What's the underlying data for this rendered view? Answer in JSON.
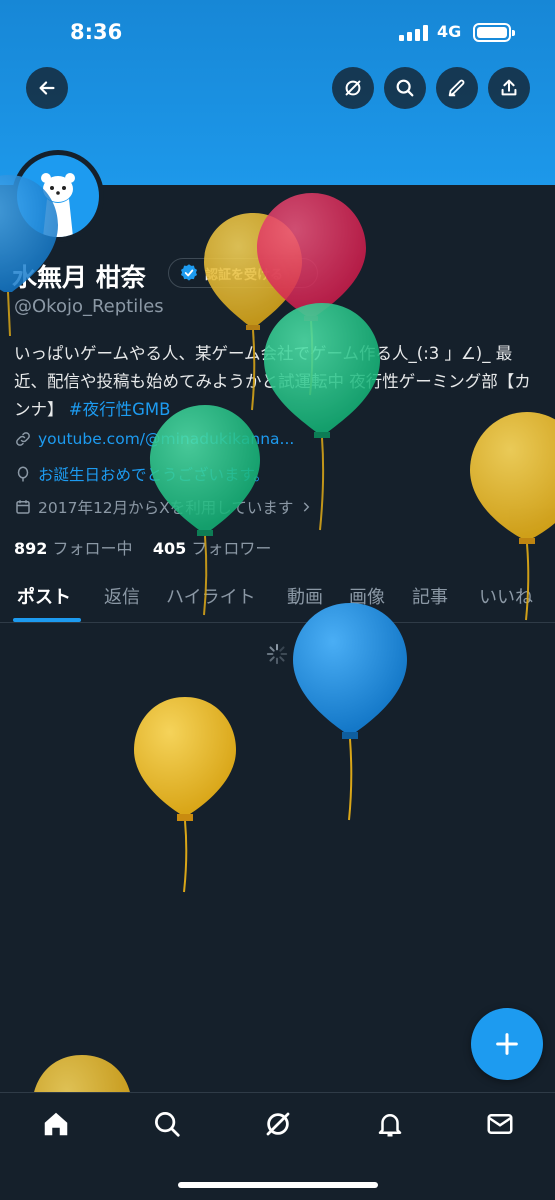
{
  "status_bar": {
    "time": "8:36",
    "network": "4G"
  },
  "header": {
    "back_icon": "arrow-left-icon",
    "grok_icon": "grok-icon",
    "search_icon": "search-icon",
    "compose_icon": "pencil-icon",
    "share_icon": "share-icon"
  },
  "profile": {
    "name": "水無月 柑奈",
    "verify_label": "認証を受ける",
    "handle": "@Okojo_Reptiles",
    "bio_text": "いっぱいゲームやる人、某ゲーム会社でゲーム作る人_(:3 」∠)_ 最近、配信や投稿も始めてみようかと試運転中 夜行性ゲーミング部【カンナ】",
    "bio_hashtag": "#夜行性GMB",
    "link": "youtube.com/@minadukikanna...",
    "birthday": "お誕生日おめでとうございます。",
    "joined": "2017年12月からXを利用しています",
    "following_count": "892",
    "following_label": "フォロー中",
    "followers_count": "405",
    "followers_label": "フォロワー"
  },
  "tabs": [
    "ポスト",
    "返信",
    "ハイライト",
    "動画",
    "画像",
    "記事",
    "いいね"
  ],
  "active_tab": "ポスト",
  "balloon_colors": [
    "#1d9bf0",
    "#e8b923",
    "#e0245e",
    "#23c58a"
  ],
  "nav": {
    "home": "home-icon",
    "search": "search-icon",
    "grok": "grok-icon",
    "notifications": "bell-icon",
    "messages": "mail-icon"
  },
  "fab_icon": "plus-icon"
}
